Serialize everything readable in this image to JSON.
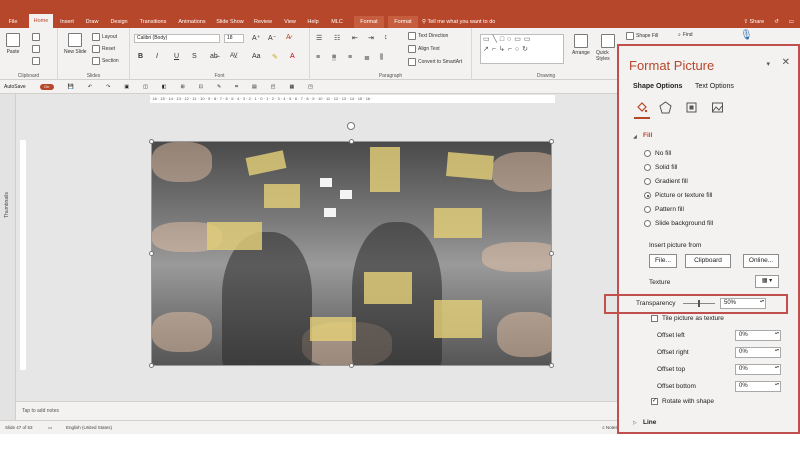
{
  "tabs": [
    "File",
    "Home",
    "Insert",
    "Draw",
    "Design",
    "Transitions",
    "Animations",
    "Slide Show",
    "Review",
    "View",
    "Help",
    "MLC",
    "Format",
    "Format"
  ],
  "active_tab": "Home",
  "tell_me": "Tell me what you want to do",
  "share_label": "Share",
  "ribbon": {
    "clipboard": {
      "paste": "Paste",
      "label": "Clipboard"
    },
    "slides": {
      "new_slide": "New Slide",
      "layout": "Layout",
      "reset": "Reset",
      "section": "Section",
      "label": "Slides"
    },
    "font": {
      "name": "Calibri (Body)",
      "size": "18",
      "label": "Font"
    },
    "paragraph": {
      "text_direction": "Text Direction",
      "align_text": "Align Text",
      "convert_smartart": "Convert to SmartArt",
      "label": "Paragraph"
    },
    "drawing": {
      "arrange": "Arrange",
      "quick_styles": "Quick Styles",
      "shape_fill": "Shape Fill",
      "label": "Drawing"
    },
    "editing": {
      "find": "Find"
    }
  },
  "qat": {
    "autosave": "AutoSave",
    "autosave_state": "On"
  },
  "thumbnails_label": "Thumbnails",
  "ruler_text": "· 16 · 15 · 14 · 13 · 12 · 11 · 10 · 9 · 8 · 7 · 6 · 5 · 4 · 3 · 2 · 1 · 0 · 1 · 2 · 3 · 4 · 5 · 6 · 7 · 8 · 9 · 10 · 11 · 12 · 13 · 14 · 15 · 16 ·",
  "notes_placeholder": "Tap to add notes",
  "status": {
    "slide": "Slide 47 of 53",
    "language": "English (United States)",
    "notes": "Notes"
  },
  "pane": {
    "title": "Format Picture",
    "tabs": [
      "Shape Options",
      "Text Options"
    ],
    "fill_header": "Fill",
    "fill_options": [
      {
        "label": "No fill",
        "checked": false
      },
      {
        "label": "Solid fill",
        "checked": false
      },
      {
        "label": "Gradient fill",
        "checked": false
      },
      {
        "label": "Picture or texture fill",
        "checked": true
      },
      {
        "label": "Pattern fill",
        "checked": false
      },
      {
        "label": "Slide background fill",
        "checked": false
      }
    ],
    "insert_picture_from": "Insert picture from",
    "file_btn": "File...",
    "clipboard_btn": "Clipboard",
    "online_btn": "Online...",
    "texture": "Texture",
    "transparency_label": "Transparency",
    "transparency_value": "50%",
    "transparency_fraction": 0.5,
    "tile_label": "Tile picture as texture",
    "offsets": [
      {
        "label": "Offset left",
        "value": "0%"
      },
      {
        "label": "Offset right",
        "value": "0%"
      },
      {
        "label": "Offset top",
        "value": "0%"
      },
      {
        "label": "Offset bottom",
        "value": "0%"
      }
    ],
    "rotate_label": "Rotate with shape",
    "rotate_checked": true,
    "line_header": "Line"
  },
  "colors": {
    "accent": "#b7472a",
    "highlight": "#c0504d"
  }
}
